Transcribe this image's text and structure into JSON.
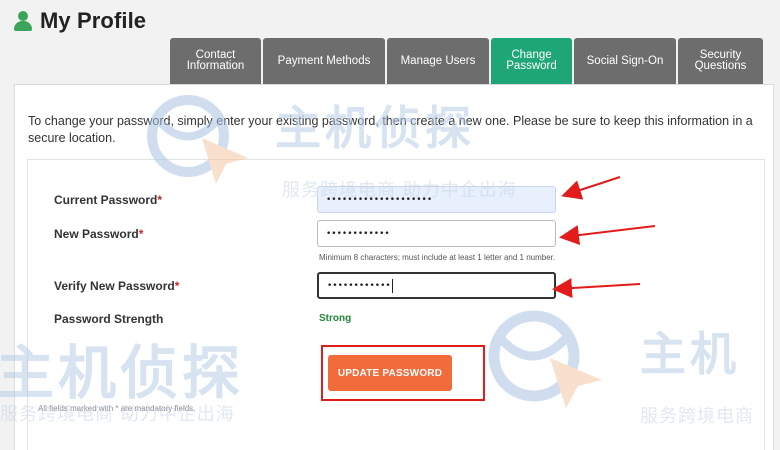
{
  "header": {
    "title": "My Profile",
    "icon": "user-icon",
    "accent_color": "#3aa45b"
  },
  "tabs": [
    {
      "label": "Contact\nInformation",
      "active": false
    },
    {
      "label": "Payment Methods",
      "active": false
    },
    {
      "label": "Manage Users",
      "active": false
    },
    {
      "label": "Change\nPassword",
      "active": true
    },
    {
      "label": "Social Sign-On",
      "active": false
    },
    {
      "label": "Security\nQuestions",
      "active": false
    }
  ],
  "intro_text": "To change your password, simply enter your existing password, then create a new one. Please be sure to keep this information in a secure location.",
  "form": {
    "current_password": {
      "label": "Current Password",
      "required_mark": "*",
      "value": "••••••••••••••••••••"
    },
    "new_password": {
      "label": "New Password",
      "required_mark": "*",
      "value": "••••••••••••",
      "hint": "Minimum 8 characters; must include at least 1 letter and 1 number."
    },
    "verify_password": {
      "label": "Verify New Password",
      "required_mark": "*",
      "value": "••••••••••••"
    },
    "strength": {
      "label": "Password Strength",
      "value": "Strong",
      "color": "#1f8a3a"
    },
    "submit_label": "UPDATE PASSWORD",
    "footnote": "All fields marked with * are mandatory fields."
  },
  "colors": {
    "tab_inactive": "#6d6d6d",
    "tab_active": "#1fa676",
    "button": "#f26b3a",
    "annotation": "#e21b1b"
  },
  "watermark": {
    "brand": "主机侦探",
    "brand_partial": "主机",
    "tagline": "服务跨境电商 助力中企出海",
    "tagline_partial": "服务跨境电商"
  }
}
